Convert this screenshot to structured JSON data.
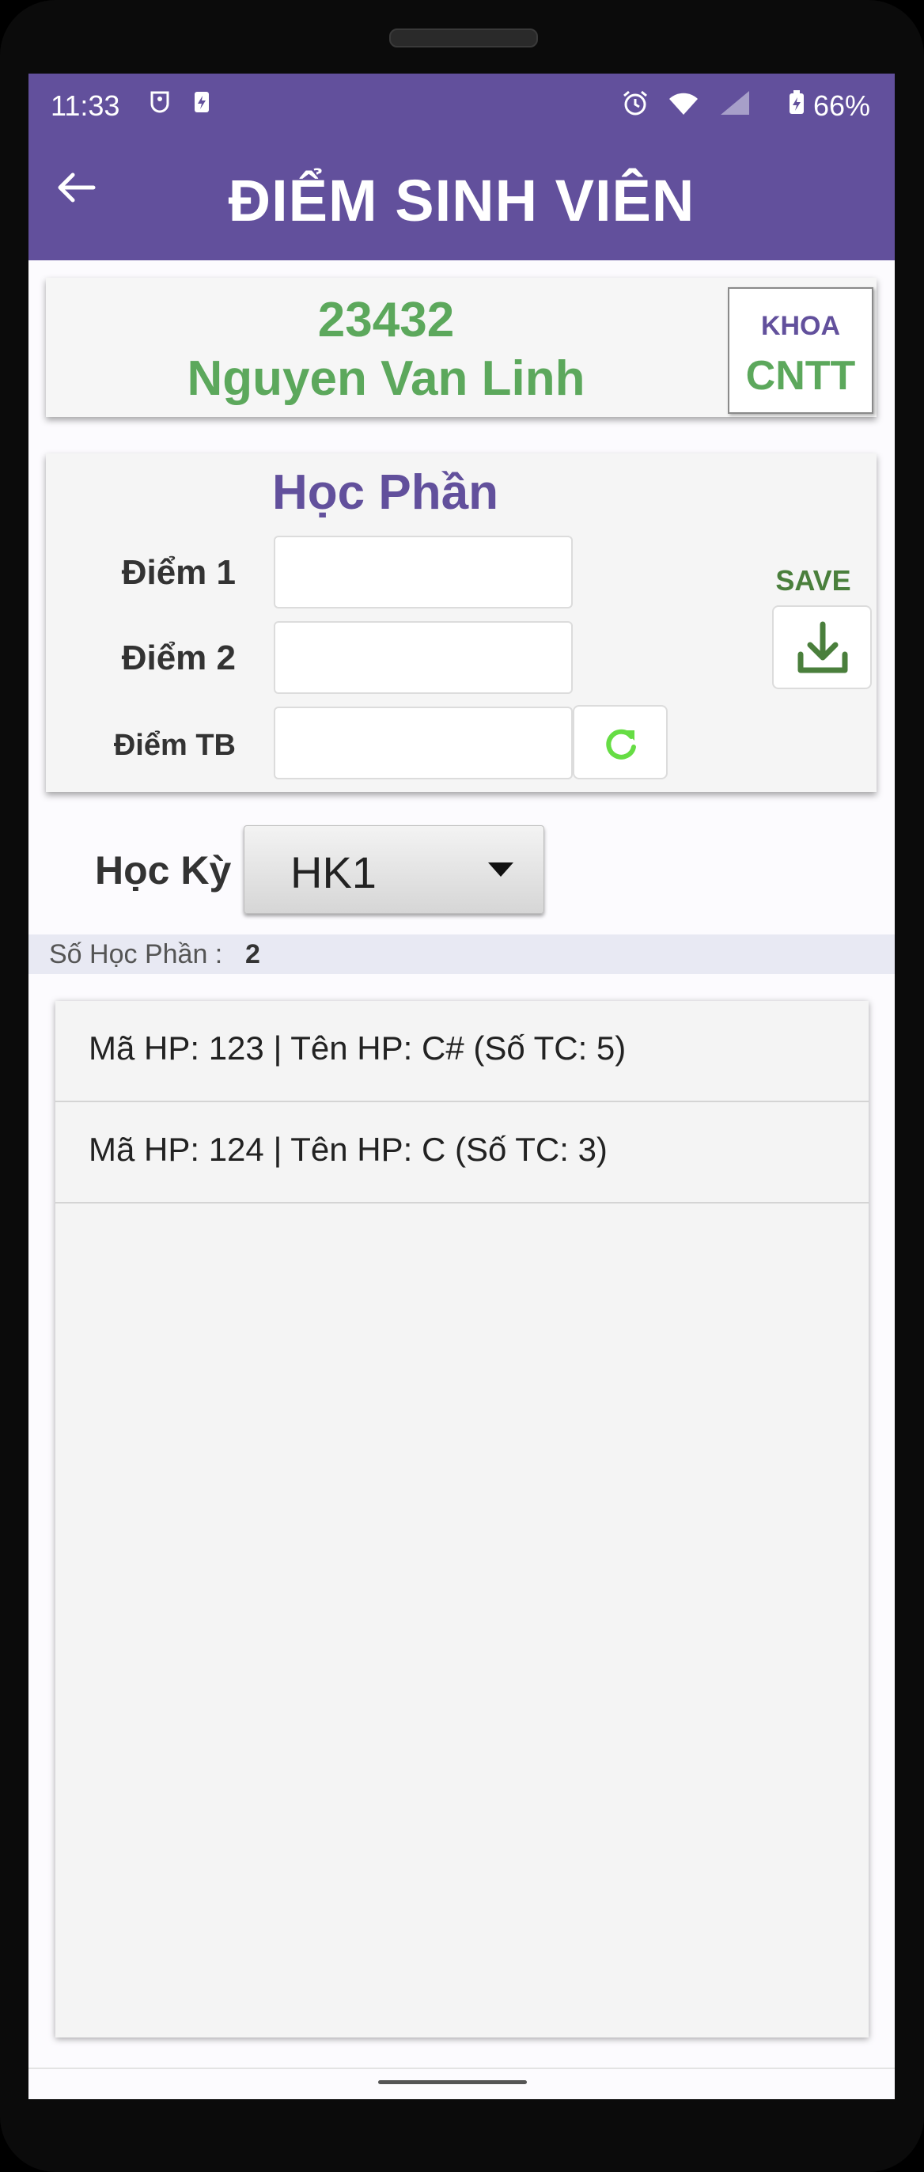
{
  "status_bar": {
    "time": "11:33",
    "battery": "66%",
    "left_icons": [
      "notification-icon",
      "battery-saver-icon"
    ],
    "right_icons": [
      "alarm-icon",
      "wifi-icon",
      "signal-icon",
      "battery-icon"
    ]
  },
  "app_bar": {
    "title": "ĐIỂM SINH VIÊN",
    "back_icon": "back-arrow-icon"
  },
  "student": {
    "id": "23432",
    "name": "Nguyen Van Linh",
    "faculty_label": "KHOA",
    "faculty_value": "CNTT"
  },
  "course_form": {
    "title": "Học Phần",
    "grade1_label": "Điểm 1",
    "grade1_value": "",
    "grade2_label": "Điểm 2",
    "grade2_value": "",
    "avg_label": "Điểm TB",
    "avg_value": "",
    "save_label": "SAVE",
    "save_icon": "download-icon",
    "refresh_icon": "refresh-icon"
  },
  "semester": {
    "label": "Học Kỳ",
    "selected": "HK1"
  },
  "count": {
    "label": "Số Học Phần :",
    "value": "2"
  },
  "courses": [
    {
      "text": "Mã HP: 123 | Tên HP: C# (Số TC: 5)"
    },
    {
      "text": "Mã HP: 124 | Tên HP: C (Số TC: 3)"
    }
  ],
  "colors": {
    "primary": "#62509c",
    "accent_green": "#5ca85c",
    "save_green": "#4a7f3c",
    "refresh_green": "#66dd44"
  }
}
